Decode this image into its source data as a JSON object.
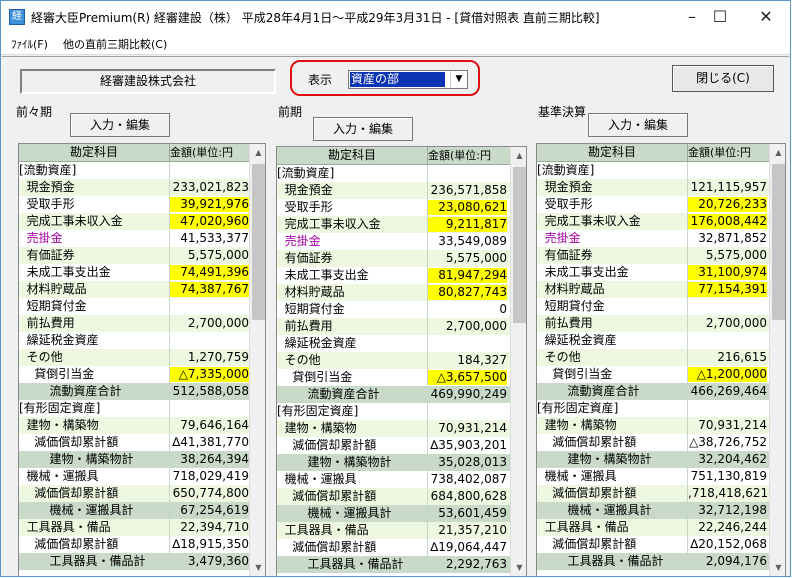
{
  "window": {
    "title": "経審大臣Premium(R)  経審建設（株）  平成28年4月1日～平成29年3月31日 - [貸借対照表  直前三期比較]",
    "controls": {
      "minimize": "–",
      "maximize": "☐",
      "close": "✕"
    }
  },
  "menu": {
    "file": "ﾌｧｲﾙ(F)",
    "compare": "他の直前三期比較(C)"
  },
  "toolbar": {
    "company": "経審建設株式会社",
    "display_label": "表示",
    "display_value": "資産の部",
    "close_button": "閉じる(C)"
  },
  "columns": {
    "account": "勘定科目",
    "amount": "金額(単位:円"
  },
  "panels": [
    {
      "title": "前々期",
      "edit_button": "入力・編集",
      "rows": [
        {
          "label": "[流動資産]",
          "value": "",
          "type": "sec"
        },
        {
          "label": "  現金預金",
          "value": "233,021,823",
          "type": ""
        },
        {
          "label": "  受取手形",
          "value": "39,921,976",
          "type": "hl"
        },
        {
          "label": "  完成工事未収入金",
          "value": "47,020,960",
          "type": "hl"
        },
        {
          "label": "  売掛金",
          "value": "41,533,377",
          "type": "pink"
        },
        {
          "label": "  有価証券",
          "value": "5,575,000",
          "type": ""
        },
        {
          "label": "  未成工事支出金",
          "value": "74,491,396",
          "type": "hl"
        },
        {
          "label": "  材料貯蔵品",
          "value": "74,387,767",
          "type": "hl"
        },
        {
          "label": "  短期貸付金",
          "value": "",
          "type": ""
        },
        {
          "label": "  前払費用",
          "value": "2,700,000",
          "type": ""
        },
        {
          "label": "  繰延税金資産",
          "value": "",
          "type": ""
        },
        {
          "label": "  その他",
          "value": "1,270,759",
          "type": ""
        },
        {
          "label": "    貸倒引当金",
          "value": "△7,335,000",
          "type": "hl"
        },
        {
          "label": "        流動資産合計",
          "value": "512,588,058",
          "type": "sub"
        },
        {
          "label": "[有形固定資産]",
          "value": "",
          "type": "sec"
        },
        {
          "label": "  建物・構築物",
          "value": "79,646,164",
          "type": ""
        },
        {
          "label": "    減価償却累計額",
          "value": "∆41,381,770",
          "type": ""
        },
        {
          "label": "        建物・構築物計",
          "value": "38,264,394",
          "type": "sub"
        },
        {
          "label": "  機械・運搬具",
          "value": "718,029,419",
          "type": ""
        },
        {
          "label": "    減価償却累計額",
          "value": "650,774,800",
          "type": ""
        },
        {
          "label": "        機械・運搬具計",
          "value": "67,254,619",
          "type": "sub"
        },
        {
          "label": "  工具器具・備品",
          "value": "22,394,710",
          "type": ""
        },
        {
          "label": "    減価償却累計額",
          "value": "∆18,915,350",
          "type": ""
        },
        {
          "label": "        工具器具・備品計",
          "value": "3,479,360",
          "type": "sub"
        }
      ]
    },
    {
      "title": "前期",
      "edit_button": "入力・編集",
      "rows": [
        {
          "label": "[流動資産]",
          "value": "",
          "type": "sec"
        },
        {
          "label": "  現金預金",
          "value": "236,571,858",
          "type": ""
        },
        {
          "label": "  受取手形",
          "value": "23,080,621",
          "type": "hl"
        },
        {
          "label": "  完成工事未収入金",
          "value": "9,211,817",
          "type": "hl"
        },
        {
          "label": "  売掛金",
          "value": "33,549,089",
          "type": "pink"
        },
        {
          "label": "  有価証券",
          "value": "5,575,000",
          "type": ""
        },
        {
          "label": "  未成工事支出金",
          "value": "81,947,294",
          "type": "hl"
        },
        {
          "label": "  材料貯蔵品",
          "value": "80,827,743",
          "type": "hl"
        },
        {
          "label": "  短期貸付金",
          "value": "0",
          "type": ""
        },
        {
          "label": "  前払費用",
          "value": "2,700,000",
          "type": ""
        },
        {
          "label": "  繰延税金資産",
          "value": "",
          "type": ""
        },
        {
          "label": "  その他",
          "value": "184,327",
          "type": ""
        },
        {
          "label": "    貸倒引当金",
          "value": "△3,657,500",
          "type": "hl"
        },
        {
          "label": "        流動資産合計",
          "value": "469,990,249",
          "type": "sub"
        },
        {
          "label": "[有形固定資産]",
          "value": "",
          "type": "sec"
        },
        {
          "label": "  建物・構築物",
          "value": "70,931,214",
          "type": ""
        },
        {
          "label": "    減価償却累計額",
          "value": "∆35,903,201",
          "type": ""
        },
        {
          "label": "        建物・構築物計",
          "value": "35,028,013",
          "type": "sub"
        },
        {
          "label": "  機械・運搬具",
          "value": "738,402,087",
          "type": ""
        },
        {
          "label": "    減価償却累計額",
          "value": "684,800,628",
          "type": ""
        },
        {
          "label": "        機械・運搬具計",
          "value": "53,601,459",
          "type": "sub"
        },
        {
          "label": "  工具器具・備品",
          "value": "21,357,210",
          "type": ""
        },
        {
          "label": "    減価償却累計額",
          "value": "∆19,064,447",
          "type": ""
        },
        {
          "label": "        工具器具・備品計",
          "value": "2,292,763",
          "type": "sub"
        }
      ]
    },
    {
      "title": "基準決算",
      "edit_button": "入力・編集",
      "rows": [
        {
          "label": "[流動資産]",
          "value": "",
          "type": "sec"
        },
        {
          "label": "  現金預金",
          "value": "121,115,957",
          "type": ""
        },
        {
          "label": "  受取手形",
          "value": "20,726,233",
          "type": "hl"
        },
        {
          "label": "  完成工事未収入金",
          "value": "176,008,442",
          "type": "hl"
        },
        {
          "label": "  売掛金",
          "value": "32,871,852",
          "type": "pink"
        },
        {
          "label": "  有価証券",
          "value": "5,575,000",
          "type": ""
        },
        {
          "label": "  未成工事支出金",
          "value": "31,100,974",
          "type": "hl"
        },
        {
          "label": "  材料貯蔵品",
          "value": "77,154,391",
          "type": "hl"
        },
        {
          "label": "  短期貸付金",
          "value": "",
          "type": ""
        },
        {
          "label": "  前払費用",
          "value": "2,700,000",
          "type": ""
        },
        {
          "label": "  繰延税金資産",
          "value": "",
          "type": ""
        },
        {
          "label": "  その他",
          "value": "216,615",
          "type": ""
        },
        {
          "label": "    貸倒引当金",
          "value": "△1,200,000",
          "type": "hl"
        },
        {
          "label": "        流動資産合計",
          "value": "466,269,464",
          "type": "sub"
        },
        {
          "label": "[有形固定資産]",
          "value": "",
          "type": "sec"
        },
        {
          "label": "  建物・構築物",
          "value": "70,931,214",
          "type": ""
        },
        {
          "label": "    減価償却累計額",
          "value": "△38,726,752",
          "type": ""
        },
        {
          "label": "        建物・構築物計",
          "value": "32,204,462",
          "type": "sub"
        },
        {
          "label": "  機械・運搬具",
          "value": "751,130,819",
          "type": ""
        },
        {
          "label": "    減価償却累計額",
          "value": ",718,418,621",
          "type": ""
        },
        {
          "label": "        機械・運搬具計",
          "value": "32,712,198",
          "type": "sub"
        },
        {
          "label": "  工具器具・備品",
          "value": "22,246,244",
          "type": ""
        },
        {
          "label": "    減価償却累計額",
          "value": "∆20,152,068",
          "type": ""
        },
        {
          "label": "        工具器具・備品計",
          "value": "2,094,176",
          "type": "sub"
        }
      ]
    }
  ],
  "colors": {
    "highlight": "#ffff00",
    "subtotal": "#c9dac9",
    "alt_row": "#eef7e0",
    "pink_text": "#a000a0",
    "select_bg": "#0a34b3",
    "focus_ring": "#e01010"
  }
}
